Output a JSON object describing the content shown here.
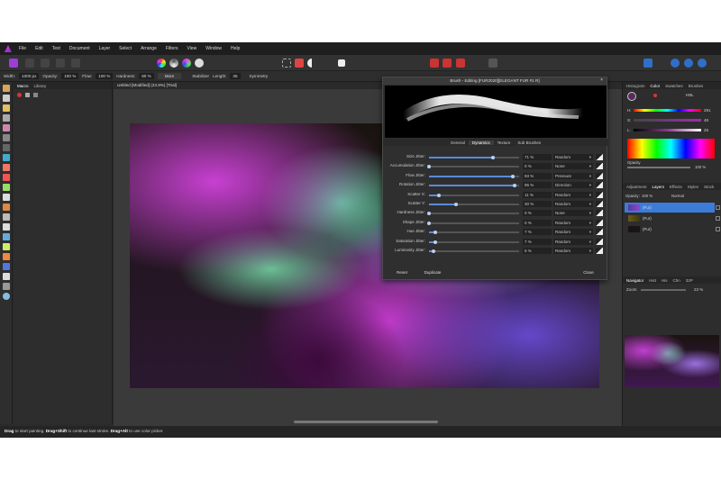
{
  "menu": [
    "File",
    "Edit",
    "Text",
    "Document",
    "Layer",
    "Select",
    "Arrange",
    "Filters",
    "View",
    "Window",
    "Help"
  ],
  "context": {
    "width_label": "Width:",
    "width_value": "1000 px",
    "opacity_label": "Opacity:",
    "opacity_value": "100 %",
    "flow_label": "Flow:",
    "flow_value": "100 %",
    "hardness_label": "Hardness:",
    "hardness_value": "80 %",
    "more": "More",
    "stabilizer": "Stabilizer",
    "length_label": "Length:",
    "length_value": "35",
    "symmetry": "Symmetry"
  },
  "left_panel": {
    "tabs": [
      "Macro",
      "Library"
    ]
  },
  "document": {
    "tab": "untitled [Modified] (23.9%) [Trial]"
  },
  "brush_dialog": {
    "title": "Brush - Editing [FUR2020][ELEGANT FUR #1 R]",
    "tabs": [
      "General",
      "Dynamics",
      "Texture",
      "Sub Brushes"
    ],
    "active_tab": "Dynamics",
    "rows": [
      {
        "label": "Size Jitter:",
        "value": "71 %",
        "fraction": 0.71,
        "controller": "Random"
      },
      {
        "label": "Accumulation Jitter:",
        "value": "0 %",
        "fraction": 0,
        "controller": "None"
      },
      {
        "label": "Flow Jitter:",
        "value": "93 %",
        "fraction": 0.93,
        "controller": "Pressure"
      },
      {
        "label": "Rotation Jitter:",
        "value": "95 %",
        "fraction": 0.95,
        "controller": "Direction"
      },
      {
        "label": "Scatter X:",
        "value": "11 %",
        "fraction": 0.11,
        "controller": "Random"
      },
      {
        "label": "Scatter Y:",
        "value": "30 %",
        "fraction": 0.3,
        "controller": "Random"
      },
      {
        "label": "Hardness Jitter:",
        "value": "0 %",
        "fraction": 0,
        "controller": "None"
      },
      {
        "label": "Shape Jitter:",
        "value": "0 %",
        "fraction": 0,
        "controller": "Random"
      },
      {
        "label": "Hue Jitter:",
        "value": "7 %",
        "fraction": 0.07,
        "controller": "Random"
      },
      {
        "label": "Saturation Jitter:",
        "value": "7 %",
        "fraction": 0.07,
        "controller": "Random"
      },
      {
        "label": "Luminosity Jitter:",
        "value": "5 %",
        "fraction": 0.05,
        "controller": "Random"
      }
    ],
    "reset": "Reset",
    "duplicate": "Duplicate",
    "close": "Close"
  },
  "right_panel": {
    "top_tabs": [
      "Histogram",
      "Color",
      "Swatches",
      "Brushes"
    ],
    "color_mode": "HSL",
    "h_label": "H:",
    "h_value": "291",
    "s_label": "S:",
    "s_value": "48",
    "l_label": "L:",
    "l_value": "25",
    "opacity_label": "Opacity",
    "opacity_value": "100 %",
    "layer_tabs": [
      "Adjustment",
      "Layers",
      "Effects",
      "Styles",
      "Stock"
    ],
    "layer_opacity_label": "Opacity:",
    "layer_opacity_value": "100 %",
    "blend_mode": "Normal",
    "layers": [
      "(Fur)",
      "(Fur)",
      "(Fur)"
    ],
    "nav_tabs": [
      "Navigator",
      "Hist",
      "His",
      "Chn",
      "32P"
    ],
    "zoom_label": "Zoom",
    "zoom_value": "23 %",
    "accent": "#3d7bd8"
  },
  "status": {
    "drag": "Drag",
    "drag_text": " to start painting. ",
    "drag_shift": "Drag+Shift",
    "shift_text": " to continue last stroke. ",
    "drag_alt": "Drag+Alt",
    "alt_text": " to use color picker."
  }
}
